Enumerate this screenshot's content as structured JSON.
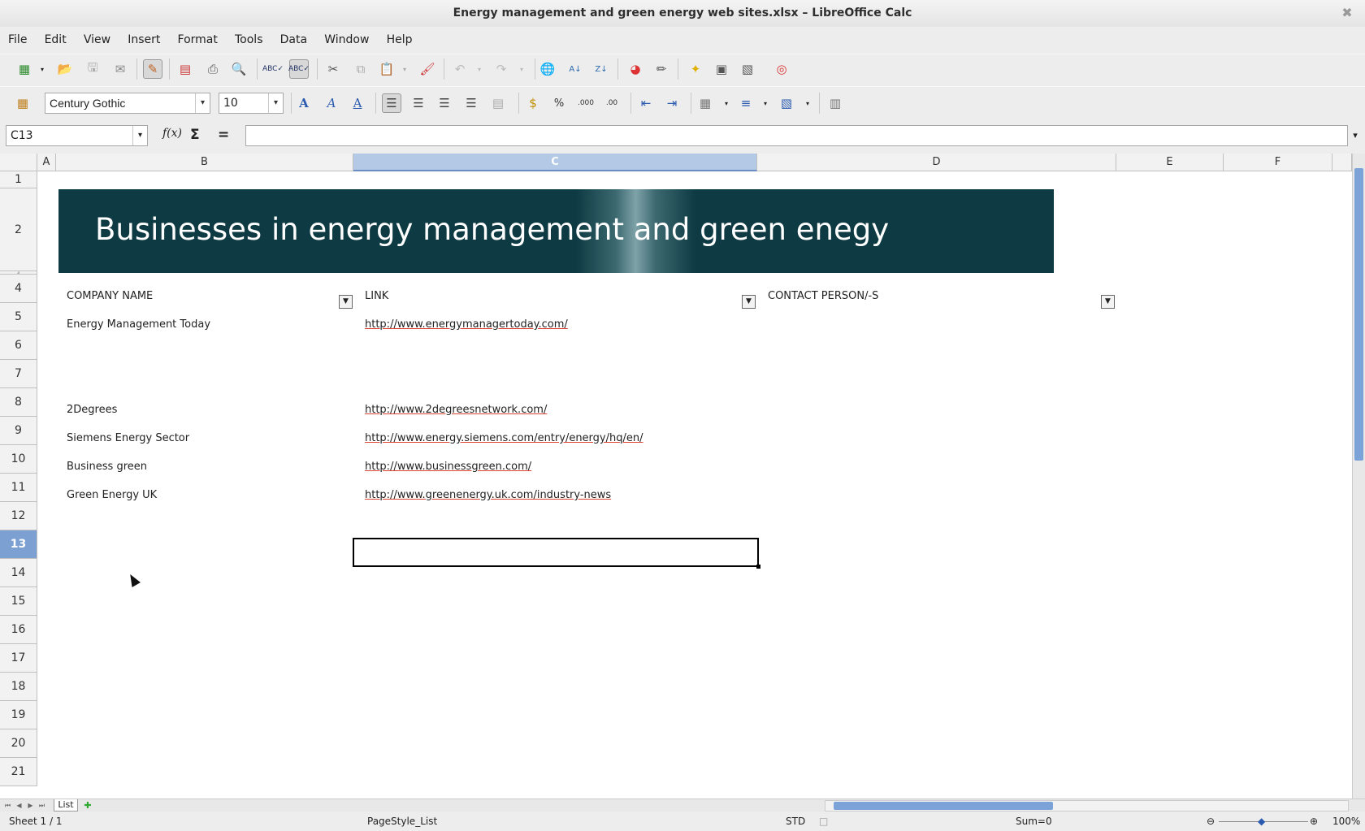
{
  "window": {
    "title": "Energy management and green energy web sites.xlsx – LibreOffice Calc"
  },
  "menu": [
    "File",
    "Edit",
    "View",
    "Insert",
    "Format",
    "Tools",
    "Data",
    "Window",
    "Help"
  ],
  "toolbar": {
    "font_name": "Century Gothic",
    "font_size": "10"
  },
  "formula": {
    "name_box": "C13",
    "fx": "f(x)",
    "sigma": "Σ",
    "equals": "=",
    "content": ""
  },
  "columns": [
    "A",
    "B",
    "C",
    "D",
    "E",
    "F"
  ],
  "rows": [
    "1",
    "2",
    "3",
    "4",
    "5",
    "6",
    "7",
    "8",
    "9",
    "10",
    "11",
    "12",
    "13",
    "14",
    "15",
    "16",
    "17",
    "18",
    "19",
    "20",
    "21"
  ],
  "sheet": {
    "banner_title": "Businesses in energy management and green enegy",
    "headers": {
      "company": "COMPANY  NAME",
      "link": "LINK",
      "contact": "CONTACT PERSON/-S"
    },
    "entries": [
      {
        "company": "Energy Management Today",
        "link": "http://www.energymanagertoday.com/"
      },
      {
        "company": "2Degrees",
        "link": "http://www.2degreesnetwork.com/"
      },
      {
        "company": "Siemens Energy Sector",
        "link": "http://www.energy.siemens.com/entry/energy/hq/en/"
      },
      {
        "company": "Business green",
        "link": "http://www.businessgreen.com/"
      },
      {
        "company": "Green Energy UK",
        "link": "http://www.greenenergy.uk.com/industry-news"
      }
    ]
  },
  "tabs": {
    "sheet_name": "List"
  },
  "status": {
    "sheet": "Sheet 1 / 1",
    "page_style": "PageStyle_List",
    "mode": "STD",
    "sum": "Sum=0",
    "zoom": "100%"
  }
}
